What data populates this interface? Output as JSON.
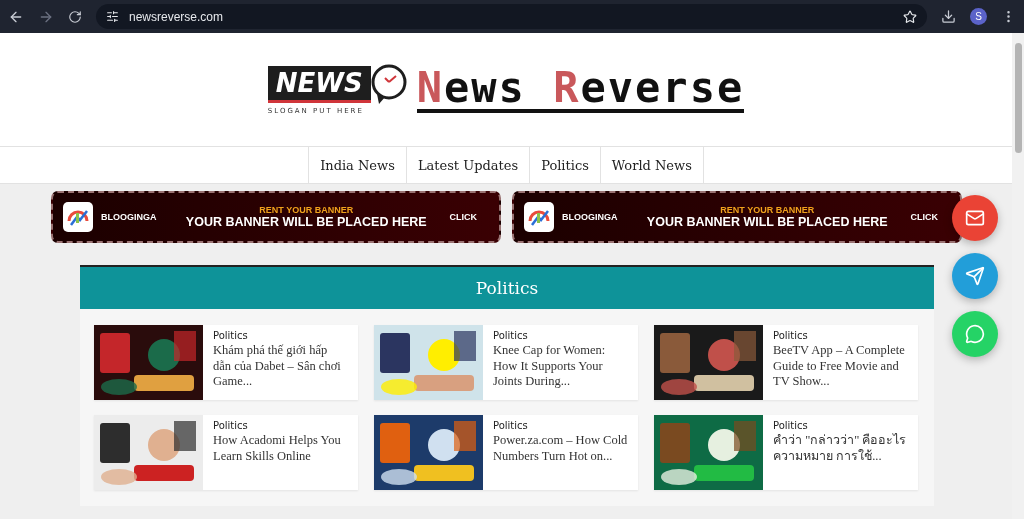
{
  "browser": {
    "url": "newsreverse.com",
    "avatar": "S"
  },
  "logo": {
    "badge": "NEWS",
    "slogan": "SLOGAN PUT HERE",
    "title_parts": [
      {
        "text": "N",
        "accent": true
      },
      {
        "text": "ews ",
        "accent": false
      },
      {
        "text": "R",
        "accent": true
      },
      {
        "text": "everse",
        "accent": false
      }
    ]
  },
  "nav": [
    {
      "label": "India News"
    },
    {
      "label": "Latest Updates"
    },
    {
      "label": "Politics"
    },
    {
      "label": "World News"
    }
  ],
  "banners": [
    {
      "brand": "BLOOGINGA",
      "kicker": "RENT YOUR BANNER",
      "headline": "YOUR BANNER WILL BE PLACED HERE",
      "action": "CLICK"
    },
    {
      "brand": "BLOOGINGA",
      "kicker": "RENT YOUR BANNER",
      "headline": "YOUR BANNER WILL BE PLACED HERE",
      "action": "CLICK"
    }
  ],
  "section": {
    "title": "Politics",
    "posts": [
      {
        "category": "Politics",
        "title": "Khám phá thế giới hấp dẫn của Dabet – Sân chơi Game..."
      },
      {
        "category": "Politics",
        "title": "Knee Cap for Women: How It Supports Your Joints During..."
      },
      {
        "category": "Politics",
        "title": "BeeTV App – A Complete Guide to Free Movie and TV Show..."
      },
      {
        "category": "Politics",
        "title": "How Acadomi Helps You Learn Skills Online"
      },
      {
        "category": "Politics",
        "title": "Power.za.com – How Cold Numbers Turn Hot on..."
      },
      {
        "category": "Politics",
        "title": "คำว่า \"กล่าวว่า\" คืออะไร ความหมาย การใช้..."
      }
    ]
  },
  "floating_buttons": [
    {
      "kind": "email"
    },
    {
      "kind": "telegram"
    },
    {
      "kind": "whatsapp"
    }
  ]
}
